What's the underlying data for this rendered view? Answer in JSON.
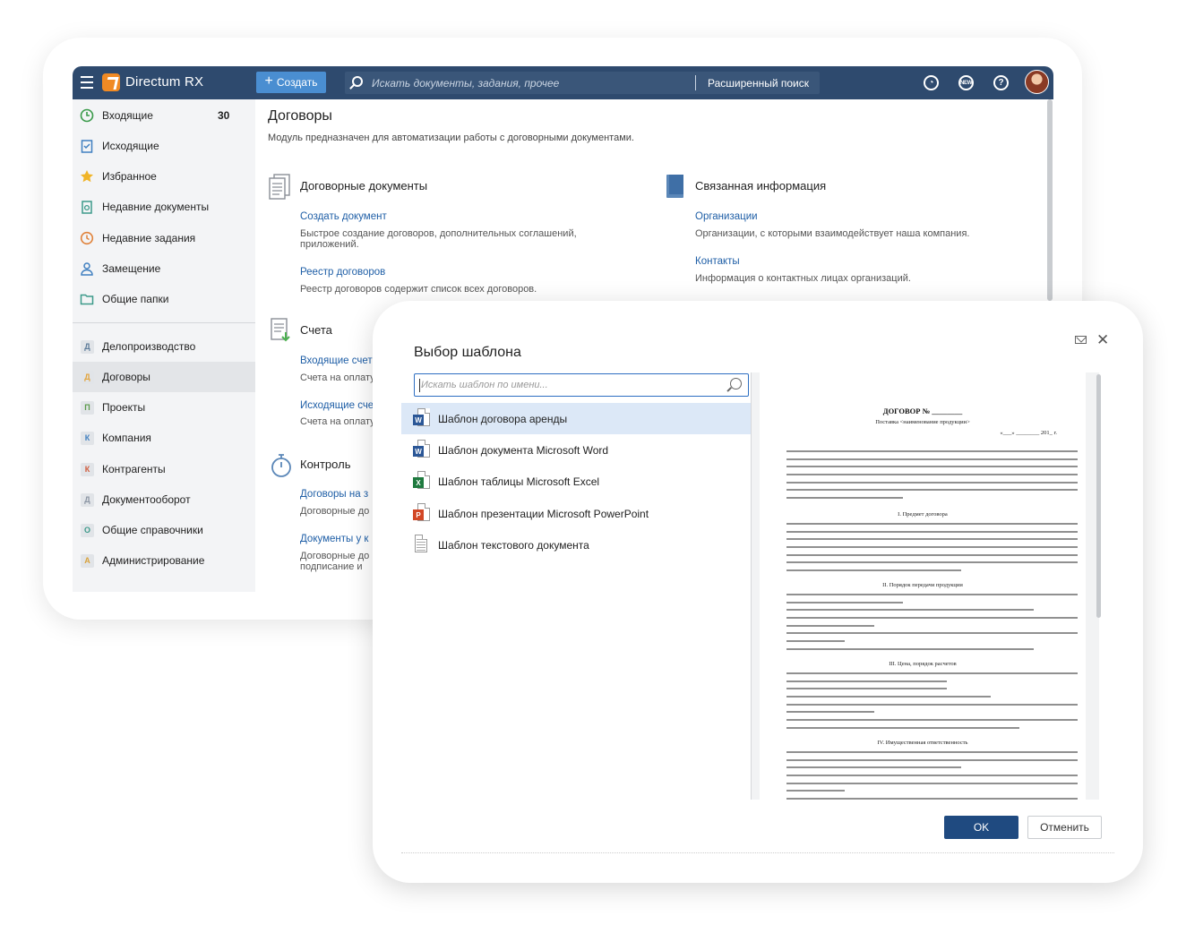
{
  "app": {
    "title": "Directum RX",
    "create_label": "Создать",
    "search_placeholder": "Искать документы, задания, прочее",
    "advanced_search": "Расширенный поиск",
    "new_badge": "NEW",
    "help_icon": "?"
  },
  "sidebar": {
    "items": [
      {
        "label": "Входящие",
        "count": "30",
        "icon": "clock-icon"
      },
      {
        "label": "Исходящие",
        "icon": "checklist-icon"
      },
      {
        "label": "Избранное",
        "icon": "star-icon"
      },
      {
        "label": "Недавние документы",
        "icon": "document-icon"
      },
      {
        "label": "Недавние задания",
        "icon": "history-icon"
      },
      {
        "label": "Замещение",
        "icon": "user-icon"
      },
      {
        "label": "Общие папки",
        "icon": "folder-icon"
      }
    ],
    "modules": [
      {
        "letter": "Д",
        "label": "Делопроизводство",
        "color": "#5b7a99"
      },
      {
        "letter": "Д",
        "label": "Договоры",
        "color": "#e2a43b"
      },
      {
        "letter": "П",
        "label": "Проекты",
        "color": "#5a9a4a"
      },
      {
        "letter": "К",
        "label": "Компания",
        "color": "#3f7fc0"
      },
      {
        "letter": "К",
        "label": "Контрагенты",
        "color": "#d05a3a"
      },
      {
        "letter": "Д",
        "label": "Документооборот",
        "color": "#8a95a3"
      },
      {
        "letter": "О",
        "label": "Общие справочники",
        "color": "#3c9a8a"
      },
      {
        "letter": "А",
        "label": "Администрирование",
        "color": "#d9a23a"
      }
    ]
  },
  "main": {
    "title": "Договоры",
    "subtitle": "Модуль предназначен для автоматизации работы с договорными документами.",
    "sections": {
      "contracts": {
        "title": "Договорные документы",
        "links": [
          {
            "label": "Создать документ",
            "desc": "Быстрое создание договоров, дополнительных соглашений, приложений."
          },
          {
            "label": "Реестр договоров",
            "desc": "Реестр договоров содержит список всех договоров."
          }
        ]
      },
      "related": {
        "title": "Связанная информация",
        "links": [
          {
            "label": "Организации",
            "desc": "Организации, с которыми взаимодействует наша компания."
          },
          {
            "label": "Контакты",
            "desc": "Информация о контактных лицах организаций."
          }
        ]
      },
      "invoices": {
        "title": "Счета",
        "links": [
          {
            "label": "Входящие счета",
            "desc": "Счета на оплату"
          },
          {
            "label": "Исходящие счета",
            "desc": "Счета на оплату"
          }
        ]
      },
      "control": {
        "title": "Контроль",
        "links": [
          {
            "label": "Договоры на з",
            "desc": "Договорные до"
          },
          {
            "label": "Документы у к",
            "desc": "Договорные до",
            "desc2": "подписание и"
          }
        ]
      }
    }
  },
  "dialog": {
    "title": "Выбор шаблона",
    "search_placeholder": "Искать шаблон по имени...",
    "templates": [
      {
        "label": "Шаблон договора аренды",
        "type": "W",
        "color": "#2b5797",
        "selected": true
      },
      {
        "label": "Шаблон документа Microsoft Word",
        "type": "W",
        "color": "#2b5797",
        "selected": false
      },
      {
        "label": "Шаблон таблицы Microsoft Excel",
        "type": "X",
        "color": "#1f7a3f",
        "selected": false
      },
      {
        "label": "Шаблон презентации Microsoft PowerPoint",
        "type": "P",
        "color": "#d24726",
        "selected": false
      },
      {
        "label": "Шаблон текстового документа",
        "type": "",
        "color": "#999999",
        "selected": false
      }
    ],
    "preview": {
      "heading": "ДОГОВОР № ________",
      "subheading": "Поставка <наименование продукции>",
      "date_line": "«___» ________ 201_ г.",
      "section_1": "I. Предмет договора",
      "section_2": "II. Порядок передачи продукции",
      "section_3": "III. Цена, порядок расчетов",
      "section_4": "IV. Имущественная ответственность"
    },
    "ok_label": "OK",
    "cancel_label": "Отменить"
  }
}
